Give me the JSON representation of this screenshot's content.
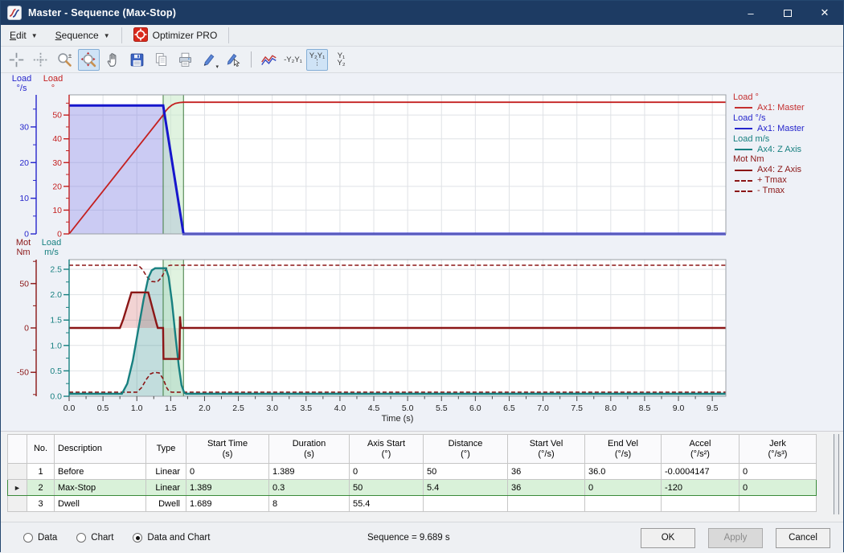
{
  "window": {
    "title": "Master - Sequence (Max-Stop)"
  },
  "menubar": {
    "items": [
      "Edit",
      "Sequence"
    ],
    "optimizer": "Optimizer PRO"
  },
  "toolbar": {
    "icons": [
      {
        "name": "tracker-icon"
      },
      {
        "name": "tracker-delta-icon"
      },
      {
        "name": "zoom-mode-icon"
      },
      {
        "name": "zoom-extents-icon",
        "selected": true
      },
      {
        "name": "pan-icon"
      },
      {
        "name": "save-icon"
      },
      {
        "name": "copy-icon"
      },
      {
        "name": "print-icon"
      },
      {
        "name": "edit-pencil-icon",
        "dropdown": true
      },
      {
        "name": "edit-pointer-icon"
      },
      {
        "name": "separator"
      },
      {
        "name": "overlay-charts-icon"
      },
      {
        "name": "axes-overlap-icon",
        "label": "-Y₂Y₁"
      },
      {
        "name": "axes-stacked-icon",
        "label": "Y₂Y₁",
        "label2": "⋮",
        "selected": true
      },
      {
        "name": "axes-ratio-icon",
        "label": "Y₁",
        "label2": "Y₂"
      }
    ]
  },
  "legend": {
    "groups": [
      {
        "header": "Load °",
        "color": "#c43030",
        "entries": [
          {
            "label": "Ax1: Master",
            "dash": false
          }
        ]
      },
      {
        "header": "Load °/s",
        "color": "#2626cc",
        "entries": [
          {
            "label": "Ax1: Master",
            "dash": false
          }
        ]
      },
      {
        "header": "Load m/s",
        "color": "#178080",
        "entries": [
          {
            "label": "Ax4: Z Axis",
            "dash": false
          }
        ]
      },
      {
        "header": "Mot Nm",
        "color": "#8b1616",
        "entries": [
          {
            "label": "Ax4: Z Axis",
            "dash": false
          },
          {
            "label": "+ Tmax",
            "dash": true
          },
          {
            "label": "- Tmax",
            "dash": true
          }
        ]
      }
    ]
  },
  "chart_data": [
    {
      "type": "line",
      "x": {
        "min": 0,
        "max": 9.7,
        "major": 0.5,
        "minor": 0.25,
        "show_labels": false,
        "axis_label": "Time (s)",
        "labels": [
          "0.0",
          "0.5",
          "1.0",
          "1.5",
          "2.0",
          "2.5",
          "3.0",
          "3.5",
          "4.0",
          "4.5",
          "5.0",
          "5.5",
          "6.0",
          "6.5",
          "7.0",
          "7.5",
          "8.0",
          "8.5",
          "9.0",
          "9.5"
        ]
      },
      "axes": {
        "outer": {
          "title": [
            "Load",
            "°/s"
          ],
          "color": "#2626cc",
          "min": 0,
          "max": 39,
          "minor": 5,
          "ticks": [
            0,
            10,
            20,
            30
          ],
          "tick_labels": [
            "0",
            "10",
            "20",
            "30"
          ]
        },
        "inner": {
          "title": [
            "Load",
            "°"
          ],
          "color": "#c42020",
          "min": 0,
          "max": 58.5,
          "minor": 5,
          "ticks": [
            0,
            10,
            20,
            30,
            40,
            50
          ],
          "tick_labels": [
            "0",
            "10",
            "20",
            "30",
            "40",
            "50"
          ]
        }
      },
      "highlight": [
        1.389,
        1.689
      ],
      "series": [
        {
          "name": "Load ° Ax1: Master",
          "axis": "inner",
          "color": "#c42020",
          "width": 1.8,
          "points": [
            [
              0,
              0
            ],
            [
              1.389,
              50
            ],
            [
              1.43,
              51.8
            ],
            [
              1.47,
              53.1
            ],
            [
              1.52,
              54.2
            ],
            [
              1.57,
              54.9
            ],
            [
              1.63,
              55.25
            ],
            [
              1.689,
              55.4
            ],
            [
              9.7,
              55.4
            ]
          ]
        },
        {
          "name": "Load °/s Ax1: Master",
          "axis": "outer",
          "color": "#1616cc",
          "width": 3,
          "fill": "rgba(130,130,226,0.42)",
          "points": [
            [
              0,
              36
            ],
            [
              1.389,
              36
            ],
            [
              1.689,
              0
            ],
            [
              9.7,
              0
            ]
          ]
        }
      ]
    },
    {
      "type": "line",
      "x": {
        "min": 0,
        "max": 9.7,
        "major": 0.5,
        "minor": 0.25,
        "show_labels": true,
        "axis_label": "Time (s)",
        "labels": [
          "0.0",
          "0.5",
          "1.0",
          "1.5",
          "2.0",
          "2.5",
          "3.0",
          "3.5",
          "4.0",
          "4.5",
          "5.0",
          "5.5",
          "6.0",
          "6.5",
          "7.0",
          "7.5",
          "8.0",
          "8.5",
          "9.0",
          "9.5"
        ]
      },
      "axes": {
        "outer": {
          "title": [
            "Mot",
            "Nm"
          ],
          "color": "#8b1616",
          "min": -77,
          "max": 77,
          "minor": 25,
          "ticks": [
            -50,
            0,
            50
          ],
          "tick_labels": [
            "-50",
            "0",
            "50"
          ]
        },
        "inner": {
          "title": [
            "Load",
            "m/s"
          ],
          "color": "#178080",
          "min": 0,
          "max": 2.69,
          "minor": 0.25,
          "ticks": [
            0,
            0.5,
            1,
            1.5,
            2,
            2.5
          ],
          "tick_labels": [
            "0.0",
            "0.5",
            "1.0",
            "1.5",
            "2.0",
            "2.5"
          ]
        }
      },
      "highlight": [
        1.389,
        1.689
      ],
      "series": [
        {
          "name": "Load m/s Ax4: Z Axis",
          "axis": "inner",
          "color": "#178080",
          "width": 2.4,
          "fill": "rgba(64,150,150,0.32)",
          "points": [
            [
              0,
              0.05
            ],
            [
              0.78,
              0.05
            ],
            [
              0.86,
              0.25
            ],
            [
              0.94,
              0.7
            ],
            [
              1.02,
              1.3
            ],
            [
              1.1,
              1.9
            ],
            [
              1.17,
              2.33
            ],
            [
              1.22,
              2.48
            ],
            [
              1.27,
              2.52
            ],
            [
              1.43,
              2.52
            ],
            [
              1.47,
              2.35
            ],
            [
              1.52,
              1.85
            ],
            [
              1.57,
              1.2
            ],
            [
              1.62,
              0.6
            ],
            [
              1.66,
              0.22
            ],
            [
              1.7,
              0.07
            ],
            [
              1.73,
              0.05
            ],
            [
              9.7,
              0.05
            ]
          ]
        },
        {
          "name": "Mot Nm Ax4: Z Axis",
          "axis": "outer",
          "color": "#8b1616",
          "width": 2.4,
          "fill": "rgba(205,80,80,0.25)",
          "points": [
            [
              0,
              0
            ],
            [
              0.75,
              0
            ],
            [
              0.8,
              10
            ],
            [
              0.92,
              40
            ],
            [
              1.17,
              40
            ],
            [
              1.29,
              5
            ],
            [
              1.31,
              0
            ],
            [
              1.388,
              0
            ],
            [
              1.394,
              -35
            ],
            [
              1.63,
              -35
            ],
            [
              1.637,
              13
            ],
            [
              1.652,
              0
            ],
            [
              9.7,
              0
            ]
          ]
        },
        {
          "name": "+ Tmax",
          "axis": "inner",
          "color": "#8b1616",
          "width": 1.6,
          "dash": true,
          "points": [
            [
              0,
              2.58
            ],
            [
              1.02,
              2.58
            ],
            [
              1.08,
              2.5
            ],
            [
              1.15,
              2.35
            ],
            [
              1.22,
              2.26
            ],
            [
              1.3,
              2.25
            ],
            [
              1.36,
              2.33
            ],
            [
              1.42,
              2.48
            ],
            [
              1.46,
              2.57
            ],
            [
              1.5,
              2.58
            ],
            [
              9.7,
              2.58
            ]
          ]
        },
        {
          "name": "- Tmax",
          "axis": "inner",
          "color": "#8b1616",
          "width": 1.6,
          "dash": true,
          "points": [
            [
              0,
              0.08
            ],
            [
              1.0,
              0.08
            ],
            [
              1.07,
              0.17
            ],
            [
              1.14,
              0.33
            ],
            [
              1.2,
              0.44
            ],
            [
              1.26,
              0.47
            ],
            [
              1.33,
              0.46
            ],
            [
              1.39,
              0.34
            ],
            [
              1.44,
              0.17
            ],
            [
              1.48,
              0.09
            ],
            [
              1.52,
              0.08
            ],
            [
              9.7,
              0.08
            ]
          ]
        }
      ]
    }
  ],
  "table": {
    "headers": [
      {
        "label": "No.",
        "unit": ""
      },
      {
        "label": "Description",
        "unit": ""
      },
      {
        "label": "Type",
        "unit": ""
      },
      {
        "label": "Start Time",
        "unit": "(s)"
      },
      {
        "label": "Duration",
        "unit": "(s)"
      },
      {
        "label": "Axis Start",
        "unit": "(°)"
      },
      {
        "label": "Distance",
        "unit": "(°)"
      },
      {
        "label": "Start Vel",
        "unit": "(°/s)"
      },
      {
        "label": "End Vel",
        "unit": "(°/s)"
      },
      {
        "label": "Accel",
        "unit": "(°/s²)"
      },
      {
        "label": "Jerk",
        "unit": "(°/s³)"
      }
    ],
    "rows": [
      {
        "selected": false,
        "cells": [
          "1",
          "Before",
          "Linear",
          "0",
          "1.389",
          "0",
          "50",
          "36",
          "36.0",
          "-0.0004147",
          "0"
        ]
      },
      {
        "selected": true,
        "cells": [
          "2",
          "Max-Stop",
          "Linear",
          "1.389",
          "0.3",
          "50",
          "5.4",
          "36",
          "0",
          "-120",
          "0"
        ]
      },
      {
        "selected": false,
        "cells": [
          "3",
          "Dwell",
          "Dwell",
          "1.689",
          "8",
          "55.4",
          "",
          "",
          "",
          "",
          ""
        ]
      }
    ],
    "selector_arrow": "►"
  },
  "footer": {
    "radios": [
      {
        "label": "Data",
        "checked": false
      },
      {
        "label": "Chart",
        "checked": false
      },
      {
        "label": "Data and Chart",
        "checked": true
      }
    ],
    "sequence_text": "Sequence = 9.689 s",
    "buttons": [
      {
        "label": "OK",
        "enabled": true
      },
      {
        "label": "Apply",
        "enabled": false
      },
      {
        "label": "Cancel",
        "enabled": true
      }
    ]
  }
}
